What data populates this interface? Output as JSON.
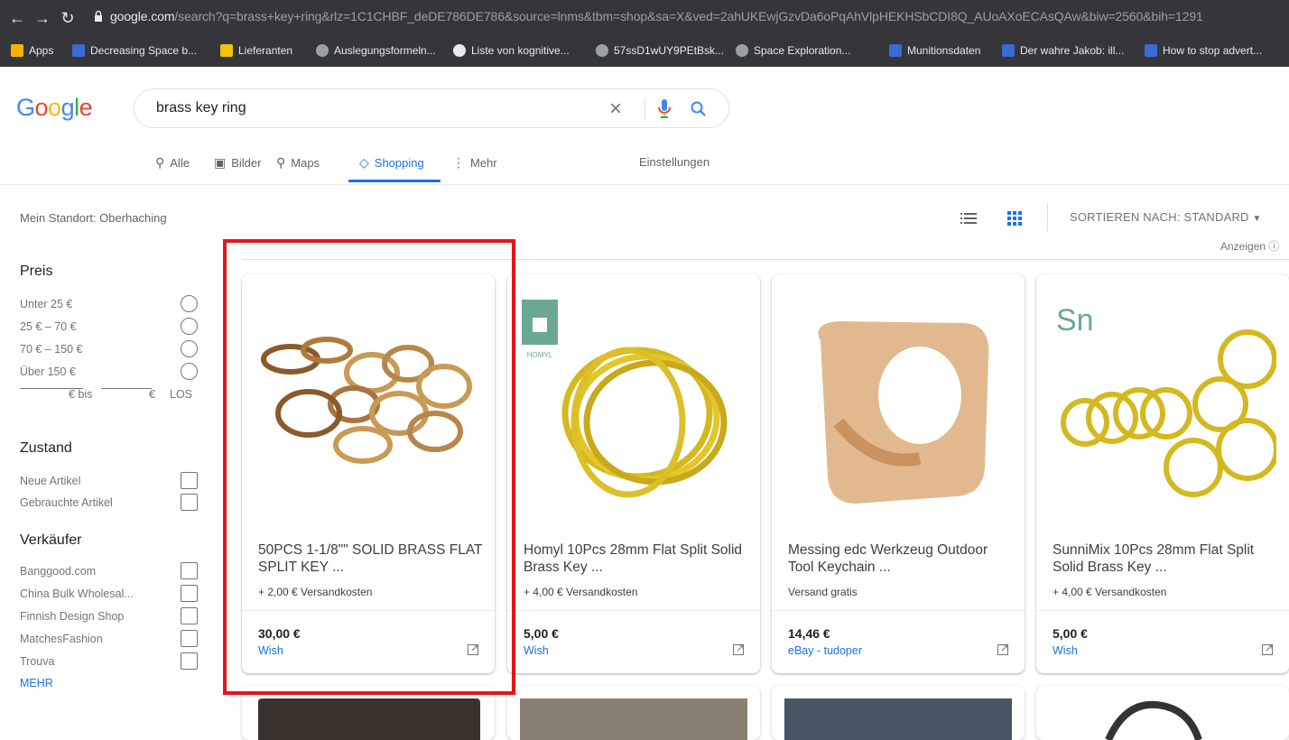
{
  "browser": {
    "url_host": "google.com",
    "url_rest": "/search?q=brass+key+ring&rlz=1C1CHBF_deDE786DE786&source=lnms&tbm=shop&sa=X&ved=2ahUKEwjGzvDa6oPqAhVlpHEKHSbCDI8Q_AUoAXoECAsQAw&biw=2560&bih=1291",
    "bookmarks": [
      {
        "label": "Apps",
        "icon": "apps-grid-icon"
      },
      {
        "label": "Decreasing Space b...",
        "icon": "page-icon"
      },
      {
        "label": "Lieferanten",
        "icon": "folder-icon"
      },
      {
        "label": "Auslegungsformeln...",
        "icon": "globe-icon"
      },
      {
        "label": "Liste von kognitive...",
        "icon": "wikipedia-icon"
      },
      {
        "label": "57ssD1wUY9PEtBsk...",
        "icon": "globe-icon"
      },
      {
        "label": "Space Exploration...",
        "icon": "globe-icon"
      },
      {
        "label": "Munitionsdaten",
        "icon": "page-icon"
      },
      {
        "label": "Der wahre Jakob: ill...",
        "icon": "page-icon"
      },
      {
        "label": "How to stop advert...",
        "icon": "page-icon"
      }
    ]
  },
  "search": {
    "logo": "Google",
    "query": "brass key ring"
  },
  "tabs": [
    {
      "label": "Alle",
      "icon": "search-icon"
    },
    {
      "label": "Bilder",
      "icon": "image-icon"
    },
    {
      "label": "Maps",
      "icon": "map-pin-icon"
    },
    {
      "label": "Shopping",
      "icon": "tag-icon"
    },
    {
      "label": "Mehr",
      "icon": "more-vert-icon"
    }
  ],
  "settings_label": "Einstellungen",
  "location": "Mein Standort: Oberhaching",
  "sort_label": "SORTIEREN NACH: STANDARD",
  "ads_label": "Anzeigen",
  "filters": {
    "price_heading": "Preis",
    "price_options": [
      "Unter 25 €",
      "25 € – 70 €",
      "70 € – 150 €",
      "Über 150 €"
    ],
    "range_from_suffix": "€ bis",
    "range_to_suffix": "€",
    "range_go": "LOS",
    "condition_heading": "Zustand",
    "condition_options": [
      "Neue Artikel",
      "Gebrauchte Artikel"
    ],
    "seller_heading": "Verkäufer",
    "seller_options": [
      "Banggood.com",
      "China Bulk Wholesal...",
      "Finnish Design Shop",
      "MatchesFashion",
      "Trouva"
    ],
    "more_label": "MEHR"
  },
  "products": [
    {
      "title": "50PCS 1-1/8\"\" SOLID BRASS FLAT SPLIT KEY ...",
      "shipping": "+ 2,00 € Versandkosten",
      "price": "30,00 €",
      "seller": "Wish"
    },
    {
      "title": "Homyl 10Pcs 28mm Flat Split Solid Brass Key ...",
      "shipping": "+ 4,00 € Versandkosten",
      "price": "5,00 €",
      "seller": "Wish",
      "logo_text": "Homyl"
    },
    {
      "title": "Messing edc Werkzeug Outdoor Tool Keychain ...",
      "shipping": "Versand gratis",
      "price": "14,46 €",
      "seller": "eBay - tudoper"
    },
    {
      "title": "SunniMix 10Pcs 28mm Flat Split Solid Brass Key ...",
      "shipping": "+ 4,00 € Versandkosten",
      "price": "5,00 €",
      "seller": "Wish",
      "logo_text": "SunniMix"
    }
  ],
  "colors": {
    "accent": "#1a73e8",
    "highlight": "#e8141c",
    "brass": "#c9a227"
  }
}
